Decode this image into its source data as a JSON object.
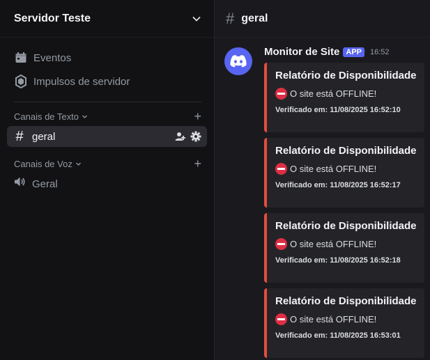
{
  "sidebar": {
    "server_name": "Servidor Teste",
    "items": [
      {
        "label": "Eventos",
        "icon": "calendar-icon"
      },
      {
        "label": "Impulsos de servidor",
        "icon": "boost-icon"
      }
    ],
    "categories": [
      {
        "label": "Canais de Texto",
        "channels": [
          {
            "label": "geral",
            "icon": "hash-icon",
            "active": true
          }
        ]
      },
      {
        "label": "Canais de Voz",
        "channels": [
          {
            "label": "Geral",
            "icon": "speaker-icon",
            "active": false
          }
        ]
      }
    ]
  },
  "channel": {
    "name": "geral"
  },
  "message": {
    "author": "Monitor de Site",
    "badge": "APP",
    "time": "16:52",
    "embeds": [
      {
        "title": "Relatório de Disponibilidade",
        "status": "O site está OFFLINE!",
        "footer": "Verificado em: 11/08/2025 16:52:10"
      },
      {
        "title": "Relatório de Disponibilidade",
        "status": "O site está OFFLINE!",
        "footer": "Verificado em: 11/08/2025 16:52:17"
      },
      {
        "title": "Relatório de Disponibilidade",
        "status": "O site está OFFLINE!",
        "footer": "Verificado em: 11/08/2025 16:52:18"
      },
      {
        "title": "Relatório de Disponibilidade",
        "status": "O site está OFFLINE!",
        "footer": "Verificado em: 11/08/2025 16:53:01"
      }
    ]
  },
  "colors": {
    "accent": "#5865f2",
    "embed_border": "#e74c3c",
    "status_icon": "#dd2e44"
  }
}
